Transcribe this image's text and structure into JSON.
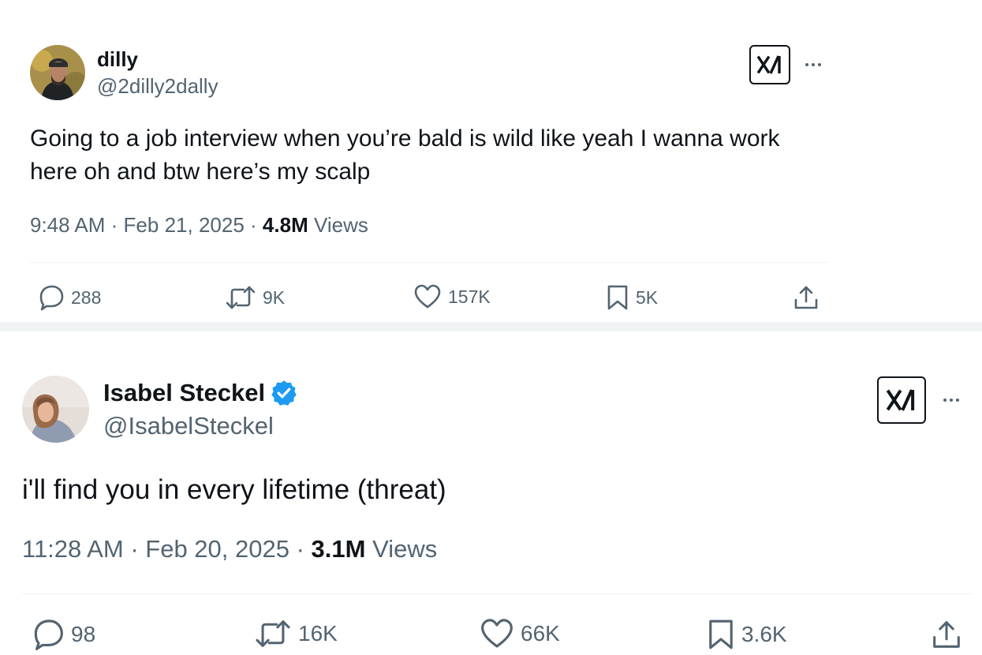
{
  "tweets": [
    {
      "display_name": "dilly",
      "handle": "@2dilly2dally",
      "verified": false,
      "text": "Going to a job interview when you’re bald is wild like yeah I wanna work here oh and btw here’s my scalp",
      "time": "9:48 AM",
      "date": "Feb 21, 2025",
      "views_count": "4.8M",
      "views_label": "Views",
      "replies": "288",
      "reposts": "9K",
      "likes": "157K",
      "bookmarks": "5K"
    },
    {
      "display_name": "Isabel Steckel",
      "handle": "@IsabelSteckel",
      "verified": true,
      "text": "i'll find you in every lifetime (threat)",
      "time": "11:28 AM",
      "date": "Feb 20, 2025",
      "views_count": "3.1M",
      "views_label": "Views",
      "replies": "98",
      "reposts": "16K",
      "likes": "66K",
      "bookmarks": "3.6K"
    }
  ],
  "meta_separator": "·",
  "icons": {
    "reply": "speech-bubble-icon",
    "repost": "repost-arrows-icon",
    "like": "heart-icon",
    "bookmark": "bookmark-icon",
    "share": "share-upload-icon",
    "grok": "xai-logo-icon",
    "more": "more-dots-icon",
    "verified": "verified-badge-icon"
  },
  "colors": {
    "text": "#0f1419",
    "secondary": "#536471",
    "verified": "#1d9bf0",
    "divider": "#eff3f4"
  }
}
